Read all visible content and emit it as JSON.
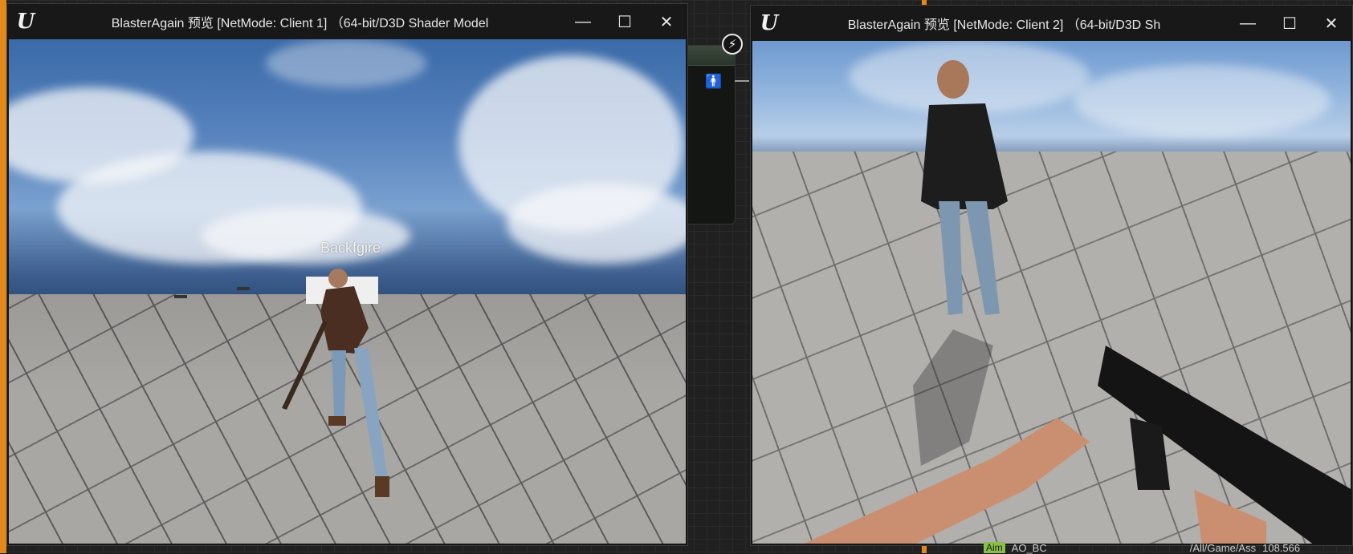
{
  "window1": {
    "title": "BlasterAgain 预览 [NetMode: Client 1] （64-bit/D3D Shader Model",
    "logo": "U",
    "minimize": "—",
    "maximize": "☐",
    "close": "✕",
    "overhead_name": "Backfgire"
  },
  "window2": {
    "title": "BlasterAgain 预览 [NetMode: Client 2] （64-bit/D3D Sh",
    "logo": "U",
    "minimize": "—",
    "maximize": "☐",
    "close": "✕"
  },
  "editor": {
    "bolt_icon": "⚡",
    "person_icon": "🚹",
    "bottom_tag": "Aim",
    "bottom_node": "AO_BC",
    "bottom_path": "/All/Game/Ass",
    "bottom_number": "108.566"
  }
}
